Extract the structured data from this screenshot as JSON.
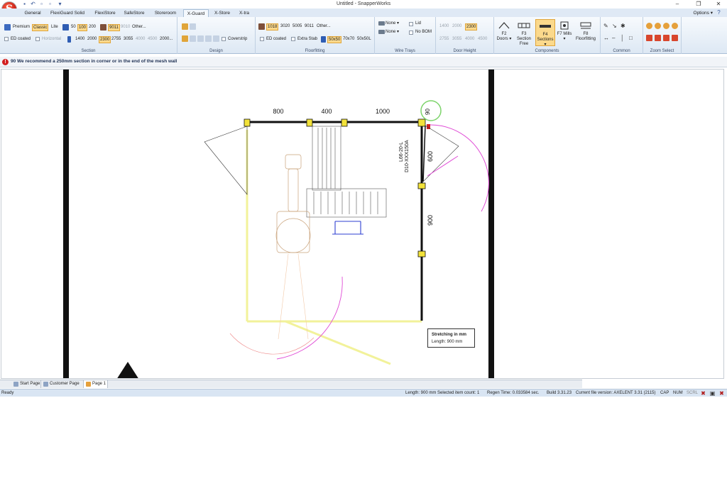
{
  "window": {
    "title": "Untitled - SnapperWorks",
    "logo_letter": "S",
    "controls": [
      "–",
      "❐",
      "✕"
    ]
  },
  "tabs": [
    "General",
    "FlexiGuard Solid",
    "FlexiStore",
    "SafeStore",
    "Storeroom",
    "X-Guard",
    "X-Store",
    "X-tra"
  ],
  "active_tab": "X-Guard",
  "options_label": "Options ▾",
  "ribbon": {
    "section": {
      "label": "Section",
      "premium": "Premium",
      "classic": "Classic",
      "lite": "Lite",
      "width_options": [
        "50",
        "100",
        "200"
      ],
      "color_options": [
        "9011",
        "9010",
        "Other..."
      ],
      "ed_coated": "ED coated",
      "horizontal": "Horizontal",
      "heights": [
        "1400",
        "2000",
        "2300",
        "2755",
        "3055",
        "4000",
        "4500",
        "2000..."
      ]
    },
    "design": {
      "label": "Design",
      "coverstrip": "Coverstrip"
    },
    "floorfitting": {
      "label": "Floorfitting",
      "colors": [
        "1018",
        "3020",
        "5005",
        "9011",
        "Other..."
      ],
      "ed_coated": "ED coated",
      "extra_stab": "Extra Stab",
      "sizes": [
        "50x50",
        "70x70",
        "50x50L"
      ]
    },
    "wire_trays": {
      "label": "Wire Trays",
      "none1": "None",
      "none2": "None",
      "lid": "Lid",
      "no_bom": "No BOM"
    },
    "door_height": {
      "label": "Door Height",
      "values_row1": [
        "1400",
        "2000",
        "2300"
      ],
      "values_row2": [
        "2755",
        "3055",
        "4000",
        "4500"
      ]
    },
    "components": {
      "label": "Components",
      "buttons": [
        "F2 Doors",
        "F3 Section Free",
        "F4 Sections",
        "F7 Mills",
        "F8 Floorfitting"
      ]
    },
    "common": {
      "label": "Common"
    },
    "zoom_select": {
      "label": "Zoom Select"
    }
  },
  "message": {
    "icon": "!",
    "text": "90 We recommend a 250mm section in corner or in the end of the mesh wall"
  },
  "drawing": {
    "dims": [
      "800",
      "400",
      "1000",
      "90",
      "600",
      "900"
    ],
    "part_label_1": "L66-20-L",
    "part_label_2": "D10-XXX150A"
  },
  "tooltip": {
    "title": "Stretching in mm",
    "length": "Length: 900 mm"
  },
  "page_tabs": [
    "Start Page",
    "Customer Page",
    "Page 1"
  ],
  "status": {
    "ready": "Ready",
    "length": "Length: 900 mm Selected item count: 1",
    "regen": "Regen Time: 0.033584 sec.",
    "build": "Build 3.31.23",
    "version": "Current file version: AXELENT 3.31 (2115)",
    "cap": "CAP",
    "num": "NUM",
    "scrl": "SCRL"
  },
  "colors": {
    "ribbon_bg": "#dde8f4",
    "highlight": "#fbd98c",
    "wall_yellow": "#f2f29a",
    "arc_magenta": "#e04cd6",
    "error_red": "#d21f1f"
  }
}
